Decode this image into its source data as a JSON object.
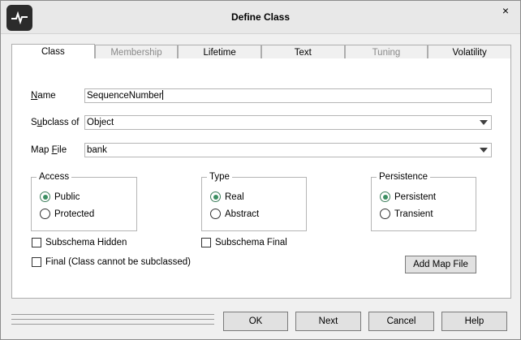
{
  "window": {
    "title": "Define Class",
    "close_glyph": "×"
  },
  "tabs": [
    {
      "label": "Class",
      "state": "active"
    },
    {
      "label": "Membership",
      "state": "disabled"
    },
    {
      "label": "Lifetime",
      "state": "enabled"
    },
    {
      "label": "Text",
      "state": "enabled"
    },
    {
      "label": "Tuning",
      "state": "disabled"
    },
    {
      "label": "Volatility",
      "state": "enabled"
    }
  ],
  "form": {
    "name_label": "Name",
    "name_value": "SequenceNumber",
    "subclass_label": "Subclass of",
    "subclass_value": "Object",
    "mapfile_label": "Map File",
    "mapfile_value": "bank"
  },
  "access": {
    "title": "Access",
    "options": [
      {
        "label": "Public",
        "selected": true
      },
      {
        "label": "Protected",
        "selected": false
      }
    ]
  },
  "type": {
    "title": "Type",
    "options": [
      {
        "label": "Real",
        "selected": true
      },
      {
        "label": "Abstract",
        "selected": false
      }
    ]
  },
  "persistence": {
    "title": "Persistence",
    "options": [
      {
        "label": "Persistent",
        "selected": true
      },
      {
        "label": "Transient",
        "selected": false
      }
    ]
  },
  "checkboxes": {
    "subschema_hidden": "Subschema Hidden",
    "subschema_final": "Subschema Final",
    "final": "Final (Class cannot be subclassed)"
  },
  "buttons": {
    "add_map_file": "Add Map File",
    "ok": "OK",
    "next": "Next",
    "cancel": "Cancel",
    "help": "Help"
  },
  "colors": {
    "radio_selected": "#3c8f62",
    "panel_bg": "#ffffff",
    "dialog_bg": "#f0f0f0"
  }
}
